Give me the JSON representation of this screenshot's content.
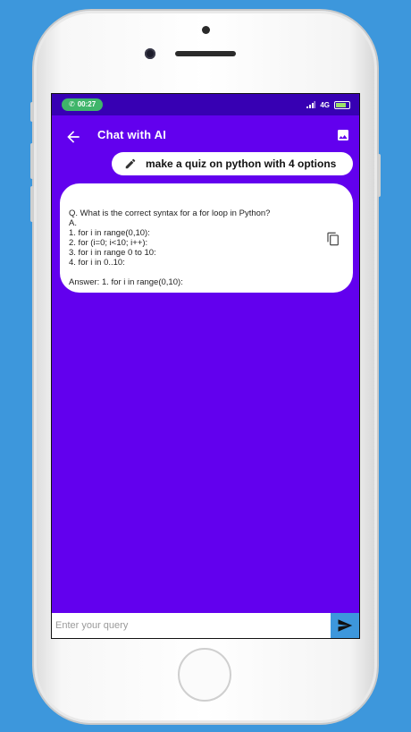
{
  "status_bar": {
    "time": "00:27",
    "network": "4G"
  },
  "appbar": {
    "title": "Chat with AI",
    "back_icon": "arrow-back-icon",
    "image_icon": "image-icon"
  },
  "messages": [
    {
      "role": "user",
      "text": "make a quiz on python with 4 options",
      "icon": "pencil-icon"
    },
    {
      "role": "ai",
      "text": "Q. What is the correct syntax for a for loop in Python?\nA.\n1. for i in range(0,10):\n2. for (i=0; i<10; i++):\n3. for i in range 0 to 10:\n4. for i in 0..10:\n\nAnswer: 1. for i in range(0,10):",
      "icon": "copy-icon"
    }
  ],
  "input": {
    "placeholder": "Enter your query",
    "value": "",
    "send_icon": "send-icon"
  },
  "colors": {
    "background": "#3d97dc",
    "primary": "#6200ee",
    "status_bar": "#3700b3",
    "send_button": "#3d97dc"
  }
}
